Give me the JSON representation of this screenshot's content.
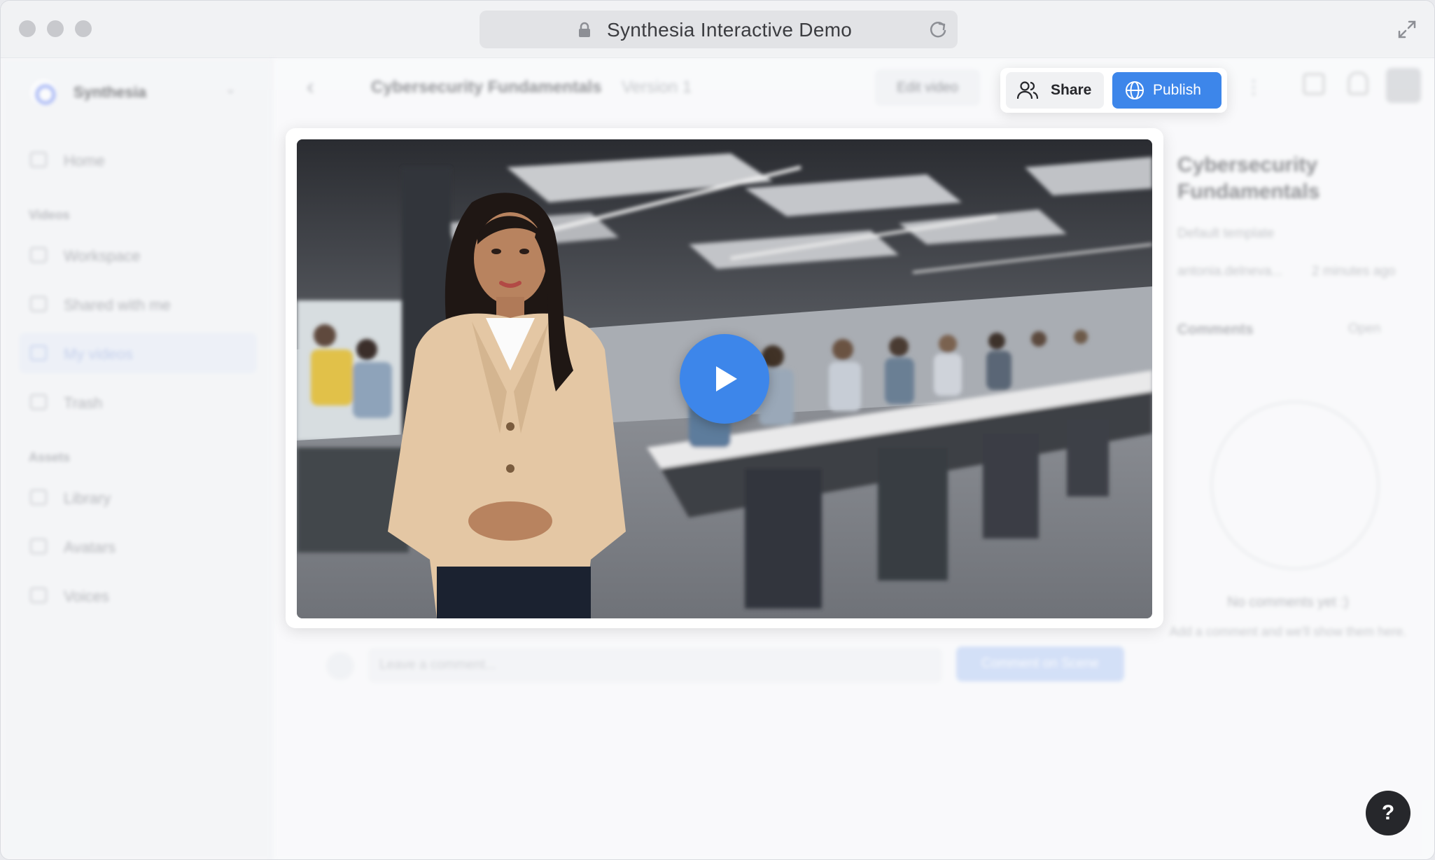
{
  "browser": {
    "title": "Synthesia Interactive Demo"
  },
  "sidebar": {
    "org_name": "Synthesia",
    "home": "Home",
    "videos_section": "Videos",
    "videos_items": [
      "Workspace",
      "Shared with me",
      "My videos",
      "Trash"
    ],
    "assets_section": "Assets",
    "assets_items": [
      "Library",
      "Avatars",
      "Voices"
    ]
  },
  "topbar": {
    "video_title": "Cybersecurity Fundamentals",
    "version": "Version 1",
    "edit_label": "Edit video",
    "share_label": "Share",
    "publish_label": "Publish"
  },
  "details": {
    "title": "Cybersecurity Fundamentals",
    "template": "Default template",
    "author": "antonia.delneva...",
    "updated": "2 minutes ago",
    "comments_heading": "Comments",
    "comments_filter": "Open",
    "empty_title": "No comments yet :)",
    "empty_sub": "Add a comment and we'll show them here."
  },
  "comment_bar": {
    "placeholder": "Leave a comment...",
    "button": "Comment on Scene"
  },
  "help": "?",
  "colors": {
    "accent": "#3d86ea"
  }
}
